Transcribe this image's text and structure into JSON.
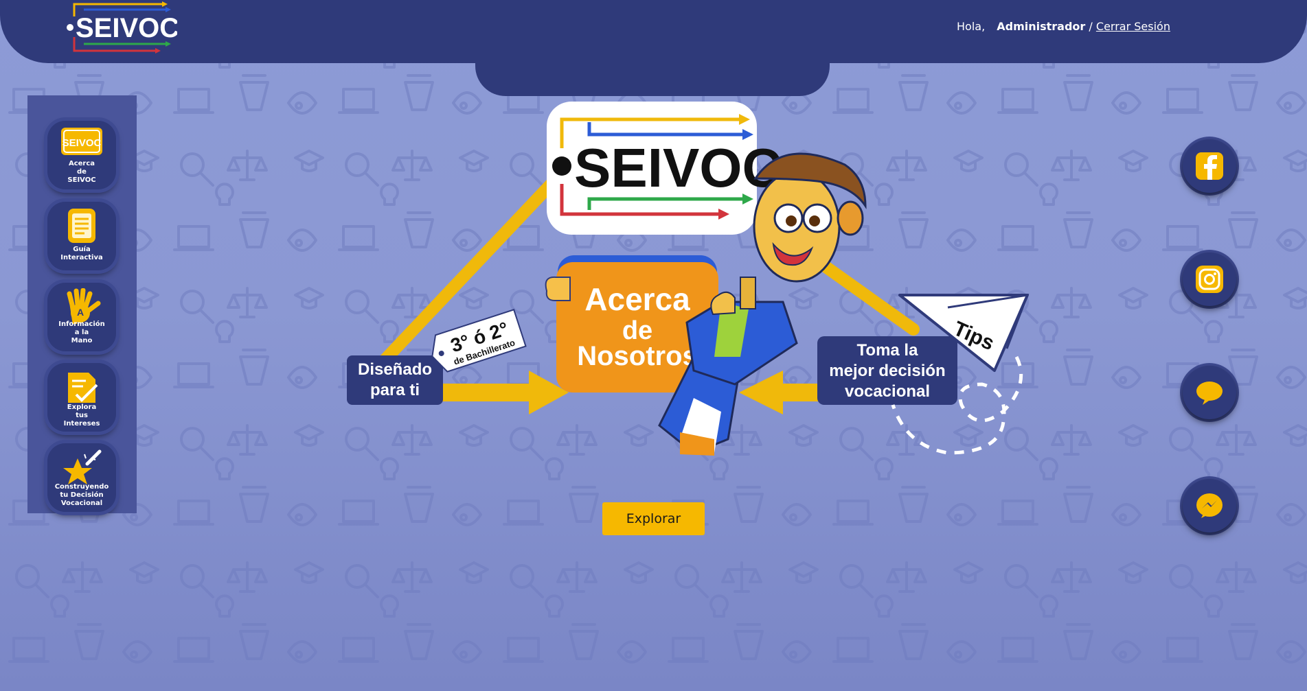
{
  "app": {
    "logo_text": "SEIVOC"
  },
  "header": {
    "greeting": "Hola,",
    "user_name": "Administrador",
    "separator": "/",
    "logout_label": "Cerrar Sesión"
  },
  "sidebar": {
    "items": [
      {
        "label_lines": [
          "Acerca",
          "de",
          "SEIVOC"
        ],
        "icon": "seivoc-logo-icon"
      },
      {
        "label_lines": [
          "Guía",
          "Interactiva"
        ],
        "icon": "guide-book-icon"
      },
      {
        "label_lines": [
          "Información",
          "a la",
          "Mano"
        ],
        "icon": "hand-info-icon"
      },
      {
        "label_lines": [
          "Explora",
          "tus",
          "Intereses"
        ],
        "icon": "checklist-icon"
      },
      {
        "label_lines": [
          "Construyendo",
          "tu Decisión",
          "Vocacional"
        ],
        "icon": "star-pencil-icon"
      }
    ]
  },
  "hero": {
    "logo_text": "SEIVOC",
    "center_line1": "Acerca",
    "center_line2": "de",
    "center_line3": "Nosotros",
    "left_line1": "Diseñado",
    "left_line2": "para ti",
    "tag_line1": "3° ó 2°",
    "tag_line2": "de Bachillerato",
    "right_line1": "Toma la",
    "right_line2": "mejor decisión",
    "right_line3": "vocacional",
    "tips_label": "Tips"
  },
  "cta": {
    "explore_label": "Explorar"
  },
  "social": [
    {
      "icon": "facebook-icon"
    },
    {
      "icon": "instagram-icon"
    },
    {
      "icon": "chat-icon"
    },
    {
      "icon": "messenger-icon"
    }
  ],
  "colors": {
    "header": "#2f3a7a",
    "background": "#8d9bd6",
    "accent_yellow": "#f6b800",
    "accent_orange": "#f0951a"
  }
}
